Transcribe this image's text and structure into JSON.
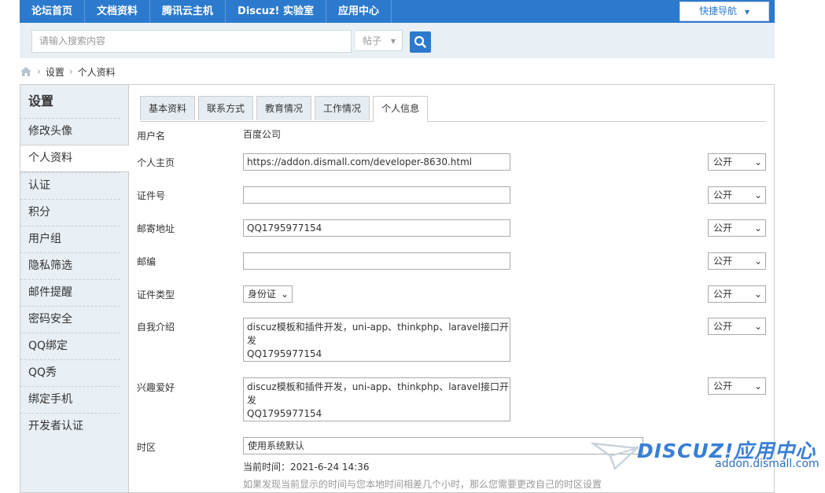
{
  "topnav": {
    "items": [
      "论坛首页",
      "文档资料",
      "腾讯云主机",
      "Discuz! 实验室",
      "应用中心"
    ],
    "quick_nav": "快捷导航"
  },
  "search": {
    "placeholder": "请输入搜索内容",
    "type": "帖子"
  },
  "breadcrumb": [
    "设置",
    "个人资料"
  ],
  "sidebar": {
    "title": "设置",
    "items": [
      "修改头像",
      "个人资料",
      "认证",
      "积分",
      "用户组",
      "隐私筛选",
      "邮件提醒",
      "密码安全",
      "QQ绑定",
      "QQ秀",
      "绑定手机",
      "开发者认证"
    ],
    "active_index": 1
  },
  "tabs": [
    "基本资料",
    "联系方式",
    "教育情况",
    "工作情况",
    "个人信息"
  ],
  "form": {
    "username_label": "用户名",
    "username_value": "百度公司",
    "homepage_label": "个人主页",
    "homepage_value": "https://addon.dismall.com/developer-8630.html",
    "idnum_label": "证件号",
    "idnum_value": "",
    "address_label": "邮寄地址",
    "address_value": "QQ1795977154",
    "zipcode_label": "邮编",
    "zipcode_value": "",
    "idtype_label": "证件类型",
    "idtype_value": "身份证",
    "bio_label": "自我介绍",
    "bio_value": "discuz模板和插件开发，uni-app、thinkphp、laravel接口开发\nQQ1795977154",
    "interest_label": "兴趣爱好",
    "interest_value": "discuz模板和插件开发，uni-app、thinkphp、laravel接口开发\nQQ1795977154",
    "timezone_label": "时区",
    "timezone_value": "使用系统默认",
    "current_time": "当前时间：2021-6-24 14:36",
    "timezone_hint": "如果发现当前显示的时间与您本地时间相差几个小时，那么您需要更改自己的时区设置",
    "privacy_value": "公开"
  },
  "watermark": {
    "brand": "DISCUZ!应用中心",
    "url": "addon.dismall.com"
  },
  "colors": {
    "nav_blue": "#2b7acd",
    "sidebar_bg": "#e8eff5"
  }
}
